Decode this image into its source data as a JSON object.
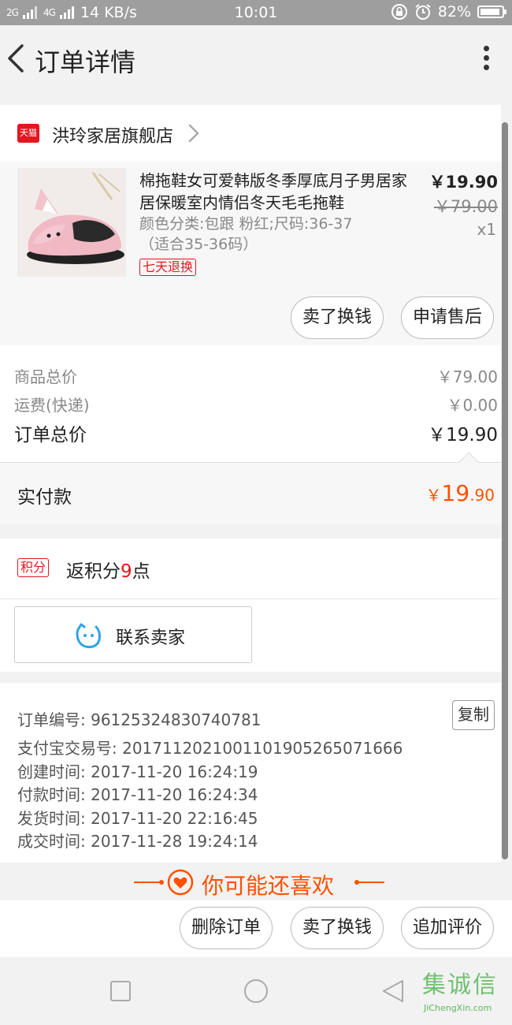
{
  "status_bar": {
    "signal1": "2G",
    "signal2": "4G",
    "speed": "14 KB/s",
    "time": "10:01",
    "battery": "82%"
  },
  "header": {
    "title": "订单详情"
  },
  "shop": {
    "badge": "天猫",
    "name": "洪玲家居旗舰店"
  },
  "product": {
    "title": "棉拖鞋女可爱韩版冬季厚底月子男居家居保暖室内情侣冬天毛毛拖鞋",
    "spec": "颜色分类:包跟 粉红;尺码:36-37（适合35-36码）",
    "tag": "七天退换",
    "price": "￥19.90",
    "original_price": "￥79.00",
    "quantity": "x1",
    "buttons": [
      "卖了换钱",
      "申请售后"
    ]
  },
  "totals": {
    "goods_label": "商品总价",
    "goods_value": "￥79.00",
    "shipping_label": "运费(快递)",
    "shipping_value": "￥0.00",
    "order_label": "订单总价",
    "order_value": "￥19.90"
  },
  "paid": {
    "label": "实付款",
    "currency": "￥",
    "integer": "19",
    "decimal": ".90"
  },
  "points": {
    "badge": "积分",
    "prefix": "返积分",
    "amount": "9",
    "suffix": "点"
  },
  "contact": {
    "label": "联系卖家"
  },
  "order_info": {
    "number": "订单编号: 96125324830740781",
    "copy_label": "复制",
    "alipay": "支付宝交易号: 2017112021001101905265071666",
    "created": "创建时间: 2017-11-20 16:24:19",
    "paid": "付款时间: 2017-11-20 16:24:34",
    "shipped": "发货时间: 2017-11-20 22:16:45",
    "completed": "成交时间: 2017-11-28 19:24:14"
  },
  "recommend": {
    "label": "你可能还喜欢"
  },
  "bottom_actions": [
    "删除订单",
    "卖了换钱",
    "追加评价"
  ],
  "watermark": {
    "text": "集诚信",
    "url_text": "JiChengXin.com"
  },
  "colors": {
    "accent": "#ff5000",
    "tmall_red": "#e4161f",
    "points_red": "#e4161f"
  }
}
